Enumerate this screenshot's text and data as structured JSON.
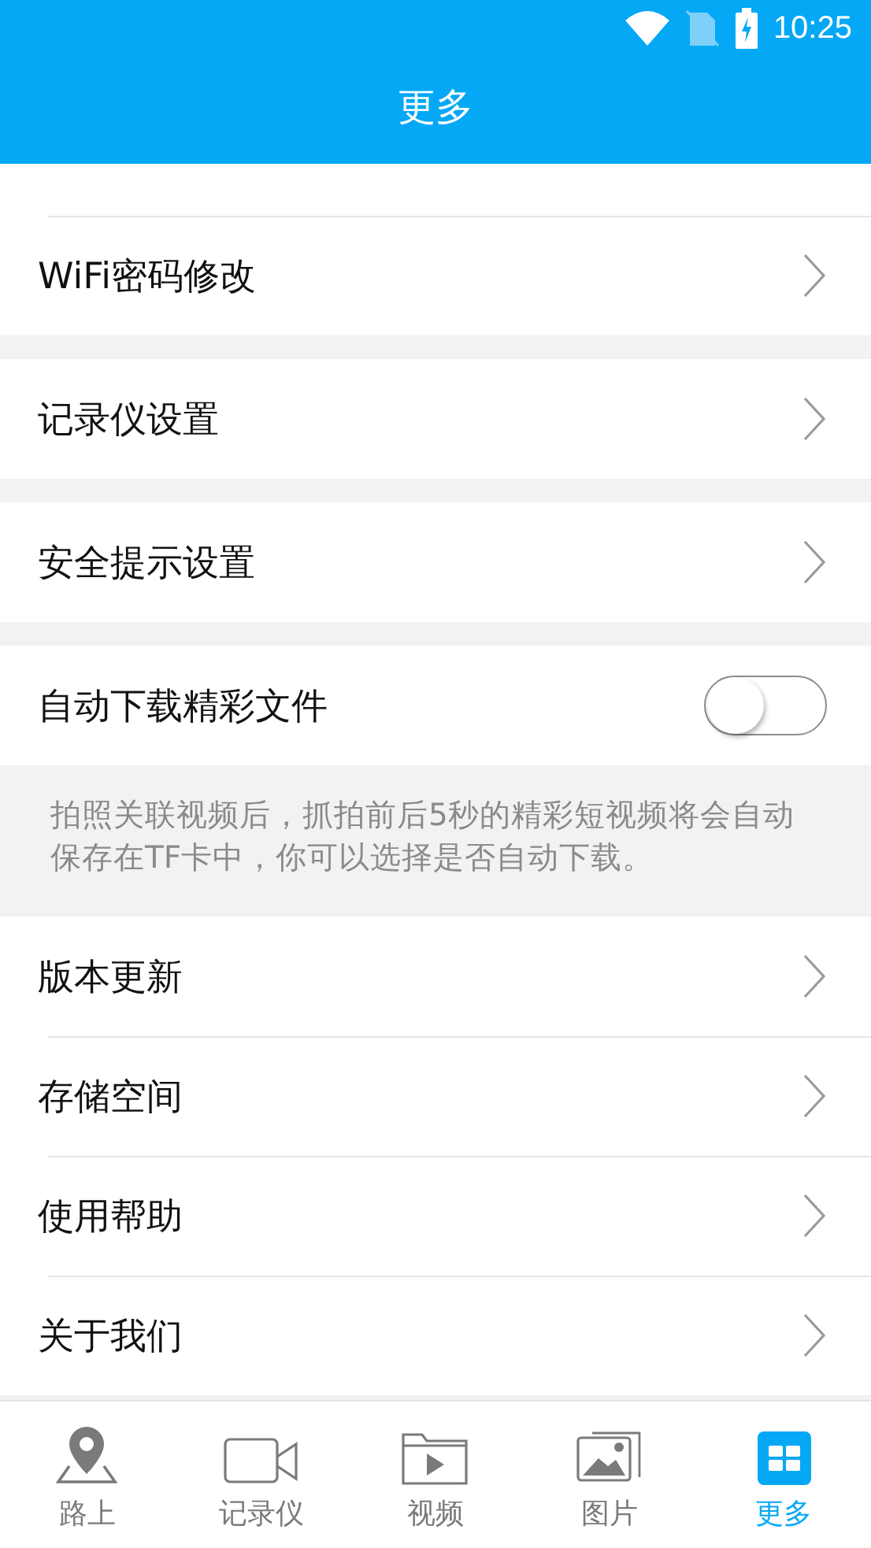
{
  "status_bar": {
    "time": "10:25"
  },
  "header": {
    "title": "更多"
  },
  "sections": [
    {
      "items": [
        {
          "kind": "link",
          "label": "WiFi密码修改"
        }
      ]
    },
    {
      "items": [
        {
          "kind": "link",
          "label": "记录仪设置"
        }
      ]
    },
    {
      "items": [
        {
          "kind": "link",
          "label": "安全提示设置"
        }
      ]
    },
    {
      "items": [
        {
          "kind": "toggle",
          "label": "自动下载精彩文件",
          "on": false
        },
        {
          "kind": "note",
          "label": "拍照关联视频后，抓拍前后5秒的精彩短视频将会自动保存在TF卡中，你可以选择是否自动下载。"
        },
        {
          "kind": "link",
          "label": "版本更新"
        },
        {
          "kind": "link",
          "label": "存储空间"
        },
        {
          "kind": "link",
          "label": "使用帮助"
        },
        {
          "kind": "link",
          "label": "关于我们"
        }
      ]
    }
  ],
  "tabs": [
    {
      "label": "路上",
      "selected": false
    },
    {
      "label": "记录仪",
      "selected": false
    },
    {
      "label": "视频",
      "selected": false
    },
    {
      "label": "图片",
      "selected": false
    },
    {
      "label": "更多",
      "selected": true
    }
  ]
}
